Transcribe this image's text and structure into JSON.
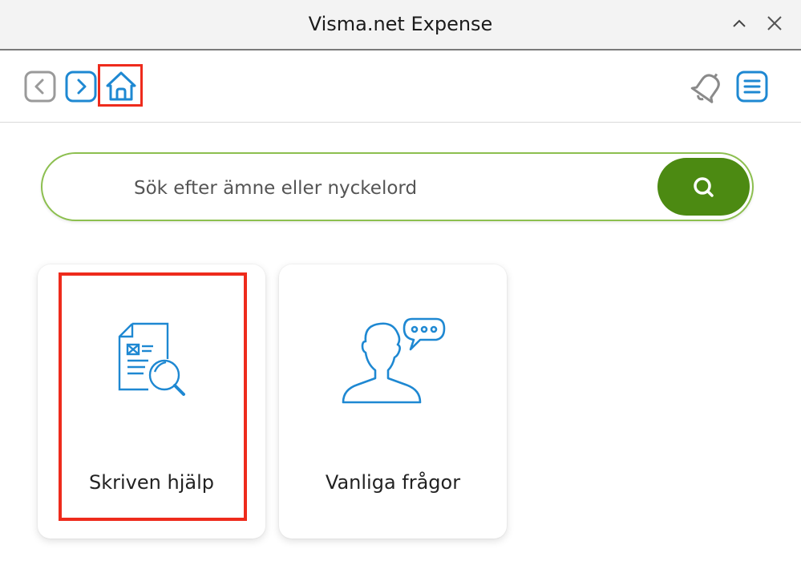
{
  "window": {
    "title": "Visma.net Expense"
  },
  "search": {
    "placeholder": "Sök efter ämne eller nyckelord",
    "value": ""
  },
  "cards": [
    {
      "label": "Skriven hjälp",
      "icon": "document-search-icon"
    },
    {
      "label": "Vanliga frågor",
      "icon": "person-speech-bubble-icon"
    }
  ],
  "colors": {
    "accent_blue": "#1e88d2",
    "search_green": "#4c8a12",
    "search_border": "#8cbf4f",
    "highlight_red": "#ee2b1c"
  }
}
